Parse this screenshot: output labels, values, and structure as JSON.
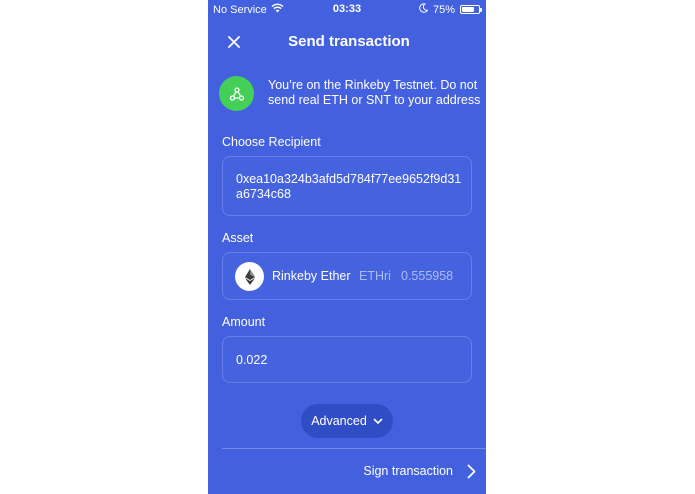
{
  "status_bar": {
    "carrier": "No Service",
    "time": "03:33",
    "battery_percent": "75%",
    "battery_level": 0.75
  },
  "header": {
    "title": "Send transaction",
    "close_icon": "close-icon"
  },
  "notice": {
    "icon": "network-icon",
    "text": "You’re on the Rinkeby Testnet. Do not send real ETH or SNT to your address"
  },
  "recipient": {
    "label": "Choose Recipient",
    "value": "0xea10a324b3afd5d784f77ee9652f9d31a6734c68"
  },
  "asset": {
    "label": "Asset",
    "name": "Rinkeby Ether",
    "symbol": "ETHri",
    "balance": "0.555958",
    "icon": "ethereum-icon"
  },
  "amount": {
    "label": "Amount",
    "value": "0.022"
  },
  "advanced": {
    "label": "Advanced"
  },
  "footer": {
    "sign_label": "Sign transaction"
  },
  "colors": {
    "background": "#4360df",
    "notice_green": "#44d058",
    "advanced_button": "#2f4dc4"
  }
}
